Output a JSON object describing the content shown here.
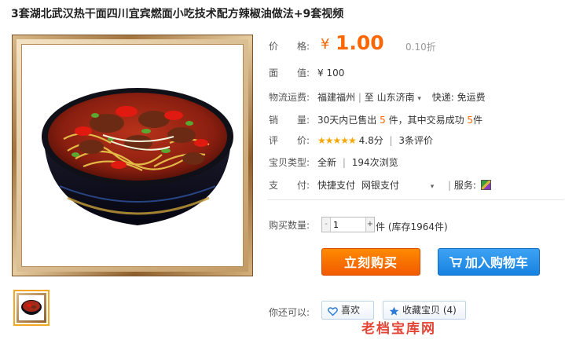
{
  "product": {
    "title": "3套湖北武汉热干面四川宜宾燃面小吃技术配方辣椒油做法+9套视频"
  },
  "price": {
    "label": "价　　格:",
    "symbol": "¥",
    "value": "1.00",
    "discount": "0.10折"
  },
  "face_value": {
    "label": "面　　值:",
    "value": "¥ 100"
  },
  "shipping": {
    "label": "物流运费:",
    "from": "福建福州",
    "sep": "|",
    "to_prefix": "至",
    "to": "山东济南",
    "express_label": "快递:",
    "express_value": "免运费"
  },
  "sales": {
    "label": "销　　量:",
    "text1": "30天内已售出",
    "sold": "5",
    "text2": "件，其中交易成功",
    "success": "5",
    "text3": "件"
  },
  "rating": {
    "label": "评　　价:",
    "stars": "★★★★★",
    "score": "4.8分",
    "sep": "|",
    "reviews": "3条评价"
  },
  "condition": {
    "label": "宝贝类型:",
    "value": "全新",
    "sep": "|",
    "views": "194次浏览"
  },
  "payment": {
    "label": "支　　付:",
    "method1": "快捷支付",
    "method2": "网银支付",
    "service_label": "服务:"
  },
  "purchase": {
    "qty_label": "购买数量:",
    "qty_value": "1",
    "minus": "-",
    "plus": "+",
    "stock": "件 (库存1964件)",
    "buy_now": "立刻购买",
    "add_to_cart": "加入购物车"
  },
  "more": {
    "label": "你还可以:",
    "like": "喜欢",
    "favorite": "收藏宝贝 (4)",
    "watermark": "老档宝库网"
  },
  "colors": {
    "accent": "#ff6600",
    "buy_button": "#f25a00",
    "cart_button": "#1682e0",
    "star": "#f7a700"
  },
  "icons": {
    "cart": "cart-icon",
    "heart": "heart-icon",
    "star": "star-icon",
    "service": "service-icon",
    "dropdown": "chevron-down-icon"
  }
}
